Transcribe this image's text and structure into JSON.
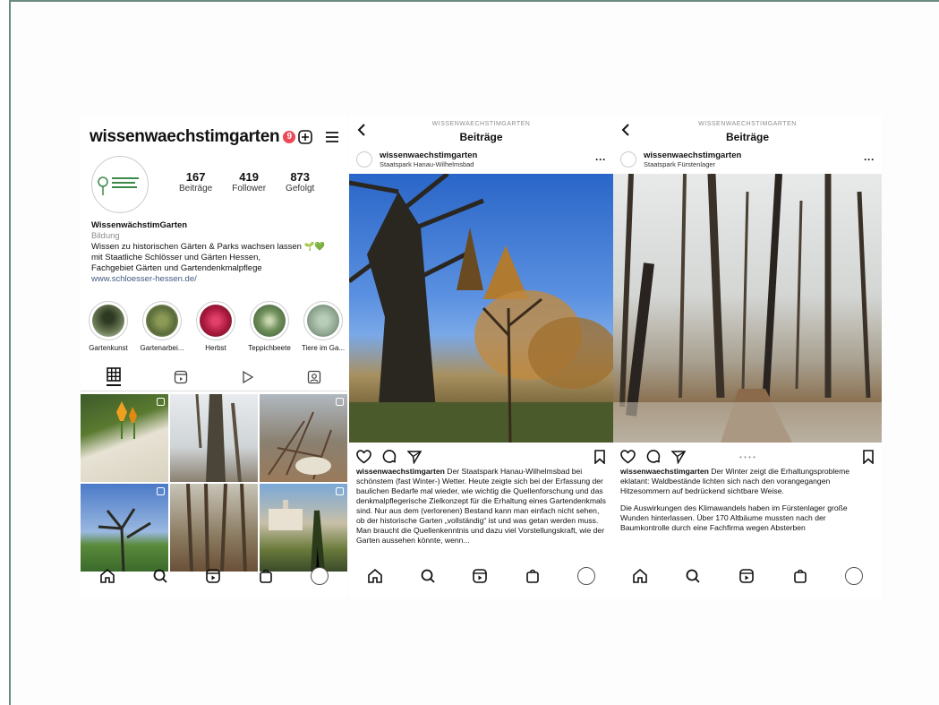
{
  "profile": {
    "username": "wissenwaechstimgarten",
    "notification_count": "9",
    "stats": [
      {
        "num": "167",
        "label": "Beiträge"
      },
      {
        "num": "419",
        "label": "Follower"
      },
      {
        "num": "873",
        "label": "Gefolgt"
      }
    ],
    "bio_name": "WissenwächstimGarten",
    "bio_category": "Bildung",
    "bio_lines": [
      "Wissen zu historischen Gärten & Parks wachsen lassen 🌱💚",
      "mit Staatliche Schlösser und Gärten Hessen,",
      "Fachgebiet Gärten und Gartendenkmalpflege"
    ],
    "bio_link": "www.schloesser-hessen.de/",
    "highlights": [
      {
        "label": "Gartenkunst",
        "color": "#4d5a3c"
      },
      {
        "label": "Gartenarbei...",
        "color": "#7c8a4d"
      },
      {
        "label": "Herbst",
        "color": "#b8224a"
      },
      {
        "label": "Teppichbeete",
        "color": "#6f8f5a"
      },
      {
        "label": "Tiere im Ga...",
        "color": "#8fa58f"
      }
    ]
  },
  "post1": {
    "header_caption": "WISSENWAECHSTIMGARTEN",
    "header_title": "Beiträge",
    "username": "wissenwaechstimgarten",
    "location": "Staatspark Hanau-Wilhelmsbad",
    "caption_user": "wissenwaechstimgarten",
    "caption_text": "Der Staatspark Hanau-Wilhelmsbad bei schönstem (fast Winter-) Wetter. Heute zeigte sich bei der Erfassung der baulichen Bedarfe mal wieder, wie wichtig die Quellenforschung und das denkmalpflegerische Zielkonzept für die Erhaltung eines Gartendenkmals sind. Nur aus dem (verlorenen) Bestand kann man einfach nicht sehen, ob der historische Garten „vollständig“ ist und was getan werden muss. Man braucht die Quellenkenntnis und dazu viel Vorstellungskraft, wie der Garten aussehen könnte, wenn..."
  },
  "post2": {
    "header_caption": "WISSENWAECHSTIMGARTEN",
    "header_title": "Beiträge",
    "username": "wissenwaechstimgarten",
    "location": "Staatspark Fürstenlager",
    "carousel": "• • • •",
    "caption_user": "wissenwaechstimgarten",
    "caption_text": "Der Winter zeigt die Erhaltungsprobleme eklatant: Waldbestände lichten sich nach den vorangegangen Hitzesommern auf bedrückend sichtbare Weise.",
    "caption_text2": "Die Auswirkungen des Klimawandels haben im Fürstenlager große Wunden hinterlassen. Über 170 Altbäume mussten nach der Baumkontrolle durch eine Fachfirma wegen Absterben"
  },
  "icons": {
    "add": "add-square-icon",
    "menu": "hamburger-menu-icon",
    "home": "home-icon",
    "search": "search-icon",
    "reels": "reels-icon",
    "shop": "shop-bag-icon",
    "heart": "heart-icon",
    "comment": "comment-icon",
    "share": "send-icon",
    "save": "bookmark-icon",
    "back": "back-chevron-icon"
  },
  "colors": {
    "notification": "#ed4956",
    "link": "#405a83"
  }
}
